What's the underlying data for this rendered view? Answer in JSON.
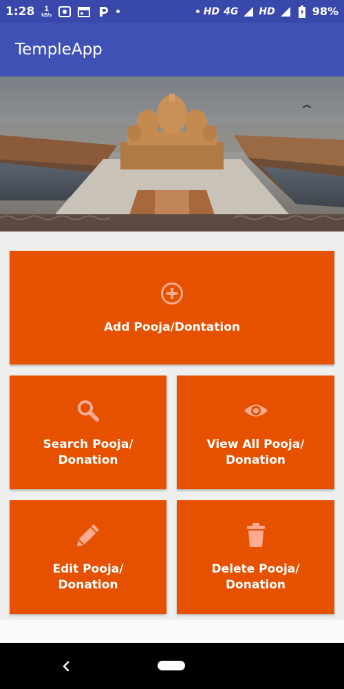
{
  "status_bar": {
    "time": "1:28",
    "speed_value": "1",
    "speed_unit": "kB/s",
    "network_label_1": "HD",
    "network_type": "4G",
    "network_label_2": "HD",
    "battery_percent": "98%",
    "icons": [
      "wifi-location-icon",
      "calendar-icon",
      "p-app-icon",
      "notification-dot-icon",
      "signal-icon",
      "battery-icon"
    ]
  },
  "app_bar": {
    "title": "TempleApp"
  },
  "banner": {
    "description_icon": "temple-photo"
  },
  "tiles": {
    "add": {
      "label": "Add Pooja/Dontation",
      "icon": "add-circle-icon"
    },
    "search": {
      "line1": "Search Pooja/",
      "line2": "Donation",
      "icon": "search-icon"
    },
    "view": {
      "line1": "View All Pooja/",
      "line2": "Donation",
      "icon": "eye-icon"
    },
    "edit": {
      "line1": "Edit Pooja/",
      "line2": "Donation",
      "icon": "pencil-icon"
    },
    "delete": {
      "line1": "Delete Pooja/",
      "line2": "Donation",
      "icon": "trash-icon"
    }
  },
  "colors": {
    "app_bar": "#3f51b5",
    "status_bar": "#3949ab",
    "tile": "#e65100",
    "tile_icon": "#ffab91",
    "background": "#efefef"
  }
}
